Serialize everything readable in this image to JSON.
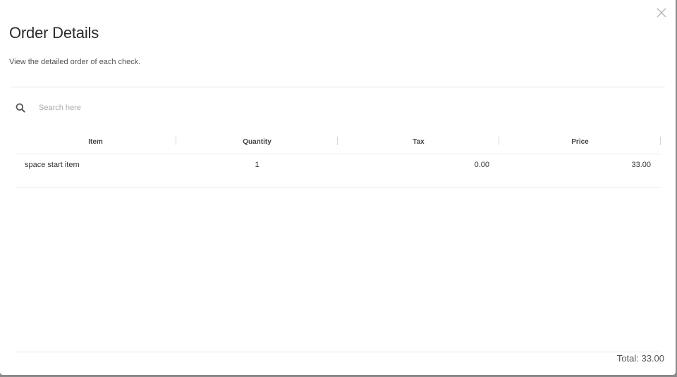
{
  "modal": {
    "title": "Order Details",
    "subtitle": "View the detailed order of each check.",
    "close_icon": "close-icon"
  },
  "search": {
    "placeholder": "Search here",
    "value": "",
    "icon": "search-icon"
  },
  "table": {
    "headers": {
      "item": "Item",
      "quantity": "Quantity",
      "tax": "Tax",
      "price": "Price"
    },
    "rows": [
      {
        "item": "space start item",
        "quantity": "1",
        "tax": "0.00",
        "price": "33.00"
      }
    ]
  },
  "footer": {
    "total_label": "Total: 33.00"
  },
  "colors": {
    "backdrop": "#8a8a8a",
    "surface": "#ffffff",
    "text": "#2b2b2b",
    "muted": "#aaaaaa"
  }
}
